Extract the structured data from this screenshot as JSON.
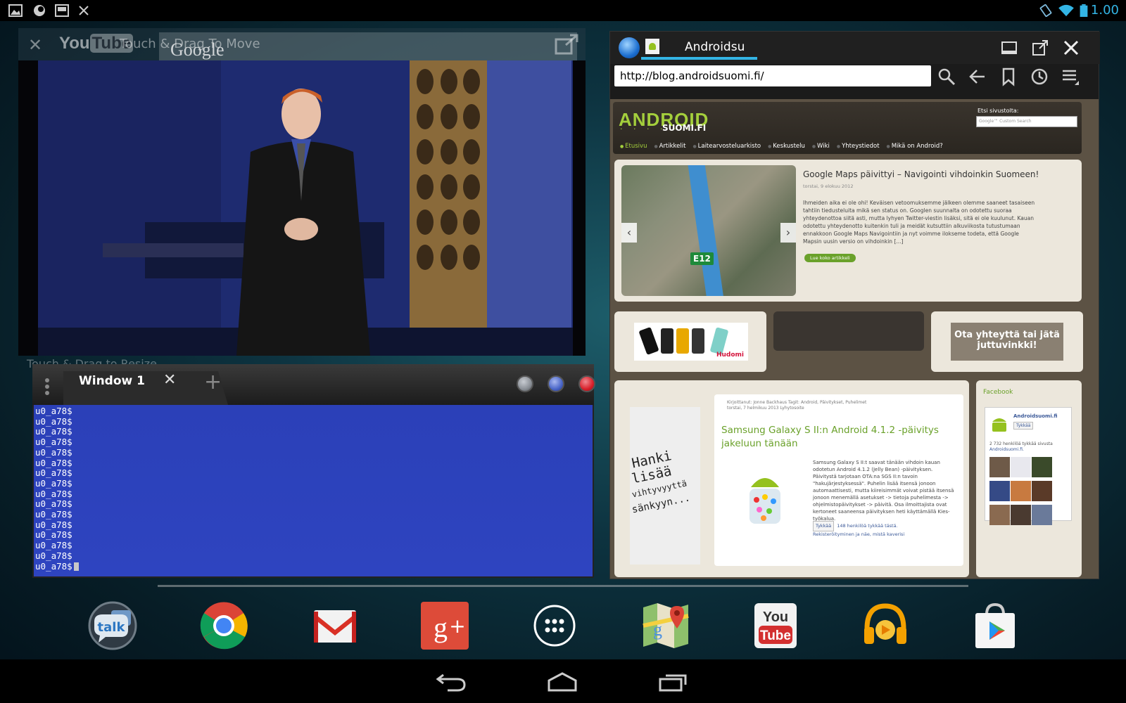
{
  "status_bar": {
    "time": "1.00",
    "left_icons": [
      "gallery-icon",
      "globe-notification-icon",
      "window-notification-icon",
      "close-notification-icon"
    ],
    "right_icons": [
      "rotation-lock-icon",
      "wifi-icon",
      "battery-icon"
    ],
    "time_color": "#33b5e5"
  },
  "youtube_window": {
    "close_icon": "close-icon",
    "logo_you": "You",
    "logo_tube": "Tube",
    "move_hint": "Touch & Drag To Move",
    "overlay_text": "Google",
    "expand_icon": "expand-icon",
    "resize_hint": "Touch & Drag to Resize"
  },
  "terminal": {
    "tab_label": "Window 1",
    "prompt_lines": [
      "u0_a78$",
      "u0_a78$",
      "u0_a78$",
      "u0_a78$",
      "u0_a78$",
      "u0_a78$",
      "u0_a78$",
      "u0_a78$",
      "u0_a78$",
      "u0_a78$",
      "u0_a78$",
      "u0_a78$",
      "u0_a78$",
      "u0_a78$",
      "u0_a78$",
      "u0_a78$"
    ],
    "buttons": [
      {
        "name": "minimize-button",
        "color": "#8a8f96"
      },
      {
        "name": "maximize-button",
        "color": "#4a66c8"
      },
      {
        "name": "close-button",
        "color": "#d8202a"
      }
    ],
    "screen_color": "#2e44c0"
  },
  "browser": {
    "tab_title": "Androidsu",
    "url": "http://blog.androidsuomi.fi/",
    "accent": "#33b5e5",
    "page": {
      "logo_android": "ANDROID",
      "logo_dots": "· · · · · ·",
      "logo_suomi": "SUOMI.FI",
      "search_label": "Etsi sivustolta:",
      "search_placeholder": "Google™ Custom Search",
      "nav": [
        "Etusivu",
        "Artikkelit",
        "Laitearvosteluarkisto",
        "Keskustelu",
        "Wiki",
        "Yhteystiedot",
        "Mikä on Android?"
      ],
      "featured": {
        "title": "Google Maps päivittyi – Navigointi vihdoinkin Suomeen!",
        "date": "torstai, 9 elokuu 2012",
        "body": "Ihmeiden aika ei ole ohi! Keväisen vetoomuksemme jälkeen olemme saaneet tasaiseen tahtiin tiedusteluita mikä sen status on. Googlen suunnalta on odotettu suoraa yhteydenottoa siitä asti, mutta lyhyen Twitter-viestin lisäksi, sitä ei ole kuulunut. Kauan odotettu yhteydenotto kuitenkin tuli ja meidät kutsuttiin alkuviikosta tutustumaan ennakkoon Google Maps Navigointiin ja nyt voimme ilokseme todeta, että Google Mapsin uusin versio on vihdoinkin [...]",
        "more": "Lue koko artikkeli",
        "road_sign": "E12"
      },
      "ad_brand": "Hudomi",
      "contact": "Ota yhteyttä tai jätä juttuvinkki!",
      "side_ad_text": [
        "Hanki",
        "lisää",
        "vihtyvyyttä",
        "sänkyyn..."
      ],
      "article": {
        "meta_line1": "Kirjoittanut: Jonne Backhaus Tagit: Android, Päivitykset, Puhelimet",
        "meta_line2": "torstai, 7 helmikuu 2013 Lyhytosoite",
        "title": "Samsung Galaxy S II:n Android 4.1.2 -päivitys jakeluun tänään",
        "body": "Samsung Galaxy S II:t saavat tänään vihdoin kauan odotetun Android 4.1.2 (Jelly Bean) -päivityksen. Päivitystä tarjotaan OTA:na SGS II:n tavoin \"hakujärjestyksessä\". Puhelin lisää itsensä jonoon automaattisesti, mutta kiireisimmät voivat pistää itsensä jonoon menemällä asetukset -> tietoja puhelimesta -> ohjelmistopäivitykset -> päivitä. Osa ilmoittajista ovat kertoneet saaneensa päivityksen heti käyttämällä Kies-työkalua.",
        "like_button": "Tykkää",
        "like_text": "148 henkilöä tykkää tästä.",
        "like_text2": "Rekisteröityminen ja näe, mistä kaverisi"
      },
      "facebook": {
        "title": "Facebook",
        "page_name": "Androidsuomi.fi",
        "like_button": "Tykkää",
        "count": "2 732 henkilöä tykkää sivusta",
        "count2": "Androidsuomi.fi."
      }
    }
  },
  "dock": {
    "apps": [
      "talk-icon",
      "chrome-icon",
      "gmail-icon",
      "google-plus-icon",
      "all-apps-icon",
      "maps-icon",
      "youtube-icon",
      "play-music-icon",
      "play-store-icon"
    ],
    "talk_label": "talk"
  },
  "nav_bar": [
    "back-icon",
    "home-icon",
    "recents-icon"
  ]
}
